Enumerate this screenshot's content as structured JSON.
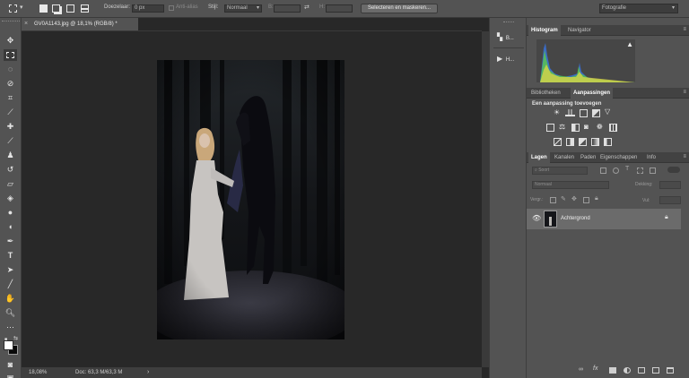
{
  "options_bar": {
    "feather_label": "Doezelaar:",
    "feather_value": "0 px",
    "antialias_label": "Anti-alias",
    "style_label": "Stijl:",
    "style_value": "Normaal",
    "width_label": "B:",
    "height_label": "H:",
    "select_mask_button": "Selecteren en maskeren...",
    "workspace_value": "Fotografie"
  },
  "document": {
    "tab_title": "GV0A1143.jpg @ 18,1% (RGB/8) *"
  },
  "status_bar": {
    "zoom": "18,08%",
    "doc_info": "Doc: 63,3 M/63,3 M",
    "arrow": "›"
  },
  "dock": {
    "items": [
      {
        "label": "B..."
      },
      {
        "label": "H..."
      }
    ]
  },
  "histogram_panel": {
    "tabs": [
      "Histogram",
      "Navigator"
    ]
  },
  "adjustments_panel": {
    "tabs": [
      "Bibliotheken",
      "Aanpassingen"
    ],
    "add_label": "Een aanpassing toevoegen"
  },
  "layers_panel": {
    "tabs": [
      "Lagen",
      "Kanalen",
      "Paden",
      "Eigenschappen",
      "Info"
    ],
    "search_placeholder": "Soort",
    "blend_mode": "Normaal",
    "opacity_label": "Dekking:",
    "lock_label": "Vergr.:",
    "fill_label": "Vul:",
    "layer_name": "Achtergrond",
    "fx_label": "fx"
  },
  "colors": {
    "ui_panel": "#535353",
    "ui_dark": "#282828",
    "layer_selected": "#6b6b6b"
  }
}
